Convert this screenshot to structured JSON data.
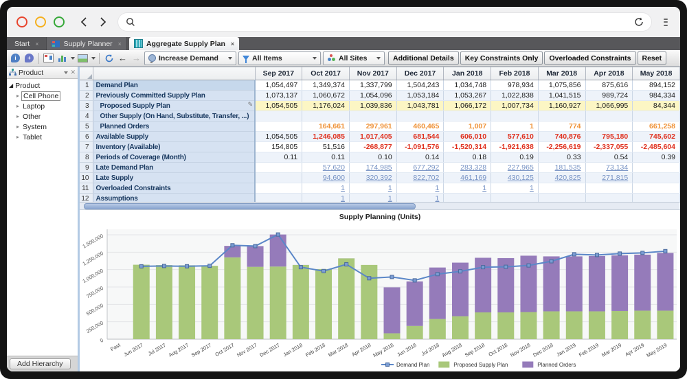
{
  "window": {
    "traffic_light_colors": [
      "#e8442d",
      "#f5b01e",
      "#35a838"
    ],
    "search_value": "",
    "icons": [
      "back-chevron",
      "forward-chevron",
      "search-magnifier",
      "reload",
      "kebab-menu"
    ]
  },
  "tabs": [
    {
      "label": "Start",
      "active": false
    },
    {
      "label": "Supply Planner",
      "active": false,
      "icon": "supply-planner-window"
    },
    {
      "label": "Aggregate Supply Plan",
      "active": true,
      "icon": "aggregate-columns"
    }
  ],
  "toolbar": {
    "left_icons": [
      "info-bubble",
      "comment-search-bubble",
      "table-view",
      "chart-view",
      "image-view",
      "refresh",
      "back-arrow",
      "forward-arrow"
    ],
    "dropdowns": [
      {
        "icon": "scenario-balloon",
        "label": "Increase Demand"
      },
      {
        "icon": "filter-funnel",
        "label": "All Items"
      },
      {
        "icon": "sites-people",
        "label": "All Sites"
      }
    ],
    "buttons": [
      "Additional Details",
      "Key Constraints Only",
      "Overloaded Constraints",
      "Reset"
    ]
  },
  "sidebar": {
    "header": {
      "title": "Product"
    },
    "tree": {
      "root": "Product",
      "items": [
        "Cell Phone",
        "Laptop",
        "Other",
        "System",
        "Tablet"
      ],
      "selected": "Cell Phone"
    },
    "footer_button": "Add Hierarchy"
  },
  "grid": {
    "columns": [
      "Sep 2017",
      "Oct 2017",
      "Nov 2017",
      "Dec 2017",
      "Jan 2018",
      "Feb 2018",
      "Mar 2018",
      "Apr 2018",
      "May 2018"
    ],
    "rows": [
      {
        "num": "1",
        "label": "Demand Plan",
        "indent": false,
        "cells": [
          "1,054,497",
          "1,349,374",
          "1,337,799",
          "1,504,243",
          "1,034,748",
          "978,934",
          "1,075,856",
          "875,616",
          "894,152"
        ],
        "styles": [
          "p",
          "p",
          "p",
          "p",
          "p",
          "p",
          "p",
          "p",
          "p"
        ]
      },
      {
        "num": "2",
        "label": "Previously Committed Supply Plan",
        "indent": false,
        "cells": [
          "1,073,137",
          "1,060,672",
          "1,054,096",
          "1,053,184",
          "1,053,267",
          "1,022,838",
          "1,041,515",
          "989,724",
          "984,334"
        ],
        "styles": [
          "p",
          "p",
          "p",
          "p",
          "p",
          "p",
          "p",
          "p",
          "p"
        ]
      },
      {
        "num": "3",
        "label": "Proposed Supply Plan",
        "indent": true,
        "editable": true,
        "row_bg": "yellow",
        "cells": [
          "1,054,505",
          "1,176,024",
          "1,039,836",
          "1,043,781",
          "1,066,172",
          "1,007,734",
          "1,160,927",
          "1,066,995",
          "84,344"
        ],
        "styles": [
          "p",
          "p",
          "p",
          "p",
          "p",
          "p",
          "p",
          "p",
          "p"
        ]
      },
      {
        "num": "4",
        "label": "Other Supply (On Hand, Substitute, Transfer, ...)",
        "indent": true,
        "cells": [
          "",
          "",
          "",
          "",
          "",
          "",
          "",
          "",
          ""
        ],
        "styles": [
          "p",
          "p",
          "p",
          "p",
          "p",
          "p",
          "p",
          "p",
          "p"
        ]
      },
      {
        "num": "5",
        "label": "Planned Orders",
        "indent": true,
        "cells": [
          "",
          "164,661",
          "297,961",
          "460,465",
          "1,007",
          "1",
          "774",
          "",
          "661,258"
        ],
        "styles": [
          "p",
          "o",
          "o",
          "o",
          "o",
          "o",
          "o",
          "p",
          "o"
        ]
      },
      {
        "num": "6",
        "label": "Available Supply",
        "indent": false,
        "cells": [
          "1,054,505",
          "1,246,085",
          "1,017,405",
          "681,544",
          "606,010",
          "577,610",
          "740,876",
          "795,180",
          "745,602"
        ],
        "styles": [
          "p",
          "r",
          "r",
          "r",
          "r",
          "r",
          "r",
          "r",
          "r"
        ]
      },
      {
        "num": "7",
        "label": "Inventory (Available)",
        "indent": false,
        "cells": [
          "154,805",
          "51,516",
          "-268,877",
          "-1,091,576",
          "-1,520,314",
          "-1,921,638",
          "-2,256,619",
          "-2,337,055",
          "-2,485,604"
        ],
        "styles": [
          "p",
          "p",
          "r",
          "r",
          "r",
          "r",
          "r",
          "r",
          "r"
        ]
      },
      {
        "num": "8",
        "label": "Periods of Coverage (Month)",
        "indent": false,
        "cells": [
          "0.11",
          "0.11",
          "0.10",
          "0.14",
          "0.18",
          "0.19",
          "0.33",
          "0.54",
          "0.39"
        ],
        "styles": [
          "p",
          "p",
          "p",
          "p",
          "p",
          "p",
          "p",
          "p",
          "p"
        ]
      },
      {
        "num": "9",
        "label": "Late Demand Plan",
        "indent": false,
        "cells": [
          "",
          "57,620",
          "174,985",
          "677,292",
          "283,328",
          "227,965",
          "181,535",
          "73,134",
          ""
        ],
        "styles": [
          "p",
          "l",
          "l",
          "l",
          "l",
          "l",
          "l",
          "l",
          "p"
        ]
      },
      {
        "num": "10",
        "label": "Late Supply",
        "indent": false,
        "cells": [
          "",
          "94,600",
          "320,392",
          "822,702",
          "461,169",
          "430,125",
          "420,825",
          "271,815",
          ""
        ],
        "styles": [
          "p",
          "l",
          "l",
          "l",
          "l",
          "l",
          "l",
          "l",
          "p"
        ]
      },
      {
        "num": "11",
        "label": "Overloaded Constraints",
        "indent": false,
        "cells": [
          "",
          "1",
          "1",
          "1",
          "1",
          "1",
          "",
          "",
          ""
        ],
        "styles": [
          "p",
          "l",
          "l",
          "l",
          "l",
          "l",
          "p",
          "p",
          "p"
        ]
      },
      {
        "num": "12",
        "label": "Assumptions",
        "indent": false,
        "cells": [
          "",
          "1",
          "1",
          "1",
          "",
          "",
          "",
          "",
          ""
        ],
        "styles": [
          "p",
          "l",
          "l",
          "l",
          "p",
          "p",
          "p",
          "p",
          "p"
        ]
      }
    ]
  },
  "chart_data": {
    "type": "bar",
    "stacked": true,
    "title": "Supply Planning (Units)",
    "categories": [
      "Past",
      "Jun 2017",
      "Jul 2017",
      "Aug 2017",
      "Sep 2017",
      "Oct 2017",
      "Nov 2017",
      "Dec 2017",
      "Jan 2018",
      "Feb 2018",
      "Mar 2018",
      "Apr 2018",
      "May 2018",
      "Jun 2018",
      "Jul 2018",
      "Aug 2018",
      "Sep 2018",
      "Oct 2018",
      "Nov 2018",
      "Dec 2018",
      "Jan 2019",
      "Feb 2019",
      "Mar 2019",
      "Apr 2019",
      "May 2019"
    ],
    "series": [
      {
        "name": "Demand Plan",
        "type": "line",
        "color": "#5b87c8",
        "values": [
          null,
          1047000,
          1052000,
          1048000,
          1054497,
          1349374,
          1337799,
          1504243,
          1034748,
          978934,
          1075856,
          875616,
          894152,
          845000,
          935000,
          975000,
          1035000,
          1040000,
          1060000,
          1120000,
          1220000,
          1210000,
          1230000,
          1240000,
          1265000
        ]
      },
      {
        "name": "Proposed Supply Plan",
        "type": "bar",
        "color": "#a9c87a",
        "values": [
          null,
          1070000,
          1065000,
          1062000,
          1054505,
          1176024,
          1039836,
          1043781,
          1066172,
          1007734,
          1160927,
          1066995,
          84344,
          190000,
          290000,
          330000,
          385000,
          385000,
          390000,
          400000,
          400000,
          400000,
          405000,
          410000,
          410000
        ]
      },
      {
        "name": "Planned Orders",
        "type": "bar",
        "color": "#957bba",
        "values": [
          null,
          0,
          0,
          0,
          0,
          164661,
          297961,
          460465,
          1007,
          1,
          774,
          0,
          661258,
          640000,
          740000,
          770000,
          785000,
          780000,
          810000,
          790000,
          790000,
          795000,
          800000,
          805000,
          830000
        ]
      }
    ],
    "ylim": [
      0,
      1500000
    ],
    "ytick_labels": [
      "0",
      "250,000",
      "500,000",
      "750,000",
      "1,000,000",
      "1,250,000",
      "1,500,000"
    ],
    "xlabel": "",
    "ylabel": "",
    "grid": true,
    "legend_position": "bottom"
  }
}
